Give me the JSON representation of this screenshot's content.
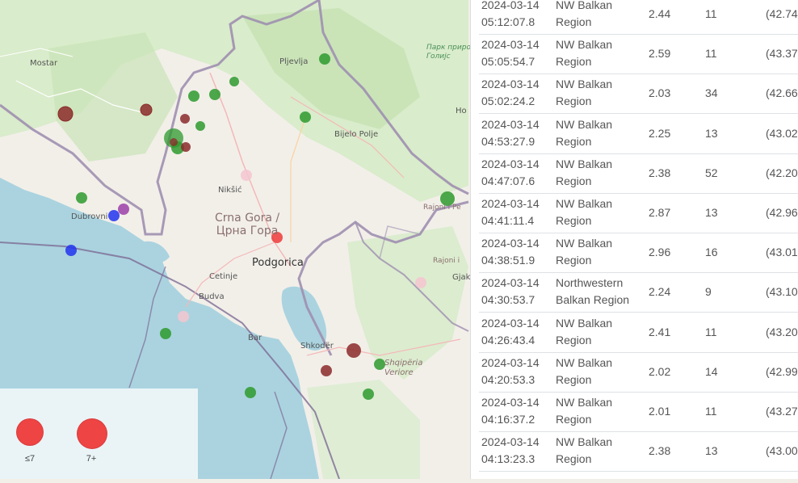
{
  "map": {
    "labels": {
      "mostar": "Mostar",
      "pljevlja": "Pljevlja",
      "park": "Парк приро\nГолијс",
      "bijelo_polje": "Bijelo Polje",
      "ho": "Ho",
      "niksic": "Nikšić",
      "crna_gora": "Crna Gora /\nЦрна Гора",
      "dubrovnik": "Dubrovni",
      "podgorica": "Podgorica",
      "rajoni_pe": "Rajoni i Pe",
      "rajoni_i": "Rajoni i",
      "gjak": "Gjak",
      "cetinje": "Cetinje",
      "budva": "Budva",
      "bar": "Bar",
      "shkoder": "Shkodër",
      "shqiperia": "Shqipëria\nVeriore"
    },
    "colors": {
      "land": "#f2efe9",
      "sea": "#aad3df",
      "forest": "#cfe8c0",
      "border": "#9e8fb0",
      "green_marker": "#2e9a2e",
      "red_marker": "#ee4444",
      "darkred_marker": "#8b2a2a",
      "blue_marker": "#2233ee",
      "purple_marker": "#9b3fa8",
      "pink_marker": "#f5c6d0"
    }
  },
  "legend": {
    "small_label": "≤7",
    "large_label": "7+"
  },
  "table": {
    "rows": [
      {
        "time": "2024-03-14 05:12:07.8",
        "region": "NW Balkan Region",
        "mag": "2.44",
        "depth": "11",
        "coord": "(42.74"
      },
      {
        "time": "2024-03-14 05:05:54.7",
        "region": "NW Balkan Region",
        "mag": "2.59",
        "depth": "11",
        "coord": "(43.37"
      },
      {
        "time": "2024-03-14 05:02:24.2",
        "region": "NW Balkan Region",
        "mag": "2.03",
        "depth": "34",
        "coord": "(42.66"
      },
      {
        "time": "2024-03-14 04:53:27.9",
        "region": "NW Balkan Region",
        "mag": "2.25",
        "depth": "13",
        "coord": "(43.02"
      },
      {
        "time": "2024-03-14 04:47:07.6",
        "region": "NW Balkan Region",
        "mag": "2.38",
        "depth": "52",
        "coord": "(42.20"
      },
      {
        "time": "2024-03-14 04:41:11.4",
        "region": "NW Balkan Region",
        "mag": "2.87",
        "depth": "13",
        "coord": "(42.96"
      },
      {
        "time": "2024-03-14 04:38:51.9",
        "region": "NW Balkan Region",
        "mag": "2.96",
        "depth": "16",
        "coord": "(43.01"
      },
      {
        "time": "2024-03-14 04:30:53.7",
        "region": "Northwestern Balkan Region",
        "mag": "2.24",
        "depth": "9",
        "coord": "(43.10"
      },
      {
        "time": "2024-03-14 04:26:43.4",
        "region": "NW Balkan Region",
        "mag": "2.41",
        "depth": "11",
        "coord": "(43.20"
      },
      {
        "time": "2024-03-14 04:20:53.3",
        "region": "NW Balkan Region",
        "mag": "2.02",
        "depth": "14",
        "coord": "(42.99"
      },
      {
        "time": "2024-03-14 04:16:37.2",
        "region": "NW Balkan Region",
        "mag": "2.01",
        "depth": "11",
        "coord": "(43.27"
      },
      {
        "time": "2024-03-14 04:13:23.3",
        "region": "NW Balkan Region",
        "mag": "2.38",
        "depth": "13",
        "coord": "(43.00"
      }
    ]
  }
}
